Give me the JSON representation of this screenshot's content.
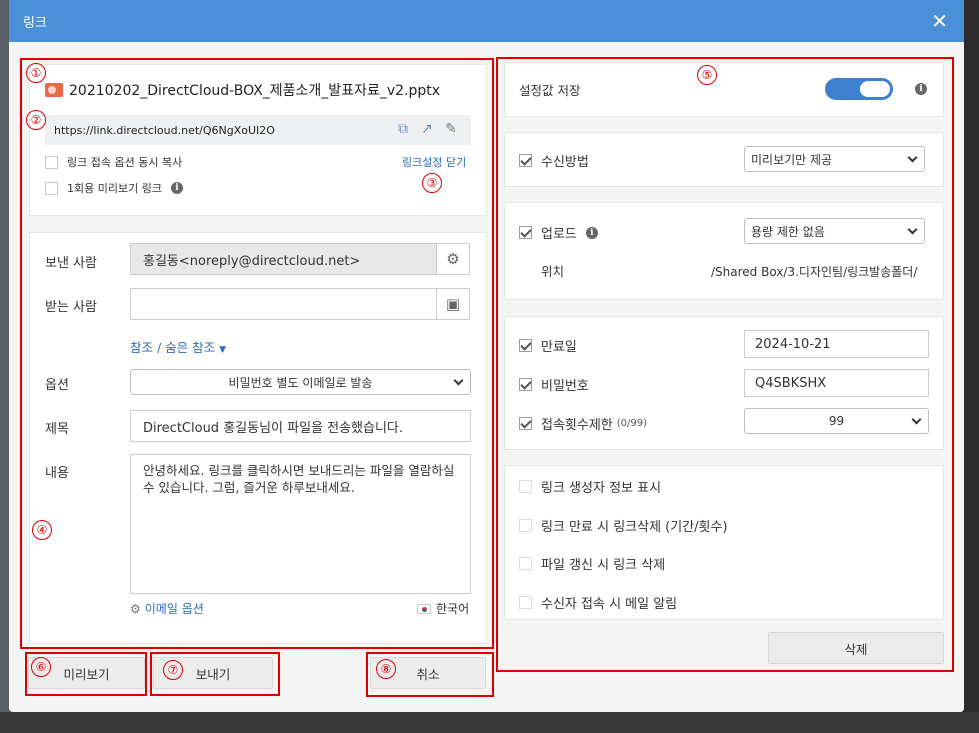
{
  "dialog": {
    "title": "링크",
    "close_icon": "close-icon"
  },
  "file": {
    "name": "20210202_DirectCloud-BOX_제품소개_발표자료_v2.pptx"
  },
  "link": {
    "url": "https://link.directcloud.net/Q6NgXoUI2O",
    "copy_with_options_label": "링크 접속 옵션 동시 복사",
    "one_time_preview_label": "1회용 미리보기 링크",
    "close_settings_label": "링크설정 닫기"
  },
  "form": {
    "sender_label": "보낸 사람",
    "sender_value": "홍길동<noreply@directcloud.net>",
    "recipient_label": "받는 사람",
    "recipient_value": "",
    "cc_bcc_label": "참조 / 숨은 참조",
    "option_label": "옵션",
    "option_value": "비밀번호 별도 이메일로 발송",
    "subject_label": "제목",
    "subject_value": "DirectCloud 홍길동님이 파일을 전송했습니다.",
    "content_label": "내용",
    "content_value": "안녕하세요. 링크를 클릭하시면 보내드리는 파일을 열람하실 수 있습니다. 그럼, 즐거운 하루보내세요.",
    "email_options_label": "이메일 옵션",
    "language_label": "한국어"
  },
  "buttons": {
    "preview": "미리보기",
    "send": "보내기",
    "cancel": "취소",
    "delete": "삭제"
  },
  "settings": {
    "save_settings_label": "설정값 저장",
    "save_settings_on": true,
    "receive_method_label": "수신방법",
    "receive_method_checked": true,
    "receive_method_value": "미리보기만 제공",
    "upload_label": "업로드",
    "upload_checked": true,
    "upload_value": "용량 제한 없음",
    "location_label": "위치",
    "location_value": "/Shared Box/3.디자인팀/링크발송폴더/",
    "expiry_label": "만료일",
    "expiry_checked": true,
    "expiry_value": "2024-10-21",
    "password_label": "비밀번호",
    "password_checked": true,
    "password_value": "Q4SBKSHX",
    "access_limit_label": "접속횟수제한",
    "access_limit_count": "(0/99)",
    "access_limit_checked": true,
    "access_limit_value": "99",
    "show_creator_label": "링크 생성자 정보 표시",
    "delete_on_expire_label": "링크 만료 시 링크삭제 (기간/횟수)",
    "delete_on_update_label": "파일 갱신 시 링크 삭제",
    "notify_on_access_label": "수신자 접속 시 메일 알림"
  },
  "annotations": [
    "①",
    "②",
    "③",
    "④",
    "⑤",
    "⑥",
    "⑦",
    "⑧"
  ],
  "colors": {
    "header": "#4a90d9",
    "annotation": "#e00000",
    "toggle": "#3f7fd0",
    "link": "#2a6db8"
  }
}
